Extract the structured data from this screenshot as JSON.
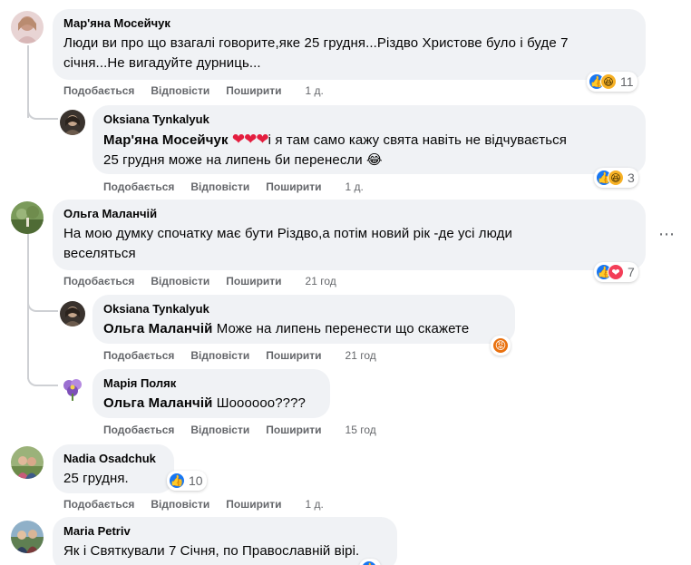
{
  "actions": {
    "like": "Подобається",
    "reply": "Відповісти",
    "share": "Поширити"
  },
  "comments": [
    {
      "author": "Мар'яна Мосейчук",
      "line1": "Люди ви про що взагалі говорите,яке 25 грудня...Різдво Христове було і буде 7",
      "line2": "січня...Не вигадуйте дурниць...",
      "time": "1 д.",
      "reactions": {
        "icons": [
          "like-icon",
          "haha-icon"
        ],
        "count": "11"
      }
    },
    {
      "author": "Oksiana Tynkalyuk",
      "mention": "Мар'яна Мосейчук",
      "hearts": "❤❤❤",
      "line1_rest": "і я там само кажу свята навіть не відчувається",
      "line2": "25 грудня може на липень би перенесли",
      "trailing_emoji": "😂",
      "time": "1 д.",
      "reactions": {
        "icons": [
          "like-icon",
          "haha-icon"
        ],
        "count": "3"
      }
    },
    {
      "author": "Ольга Маланчій",
      "line1": "На мою думку спочатку має бути Різдво,а потім новий рік -де усі люди",
      "line2": "веселяться",
      "time": "21 год",
      "reactions": {
        "icons": [
          "like-icon",
          "love-icon"
        ],
        "count": "7"
      }
    },
    {
      "author": "Oksiana Tynkalyuk",
      "mention": "Ольга Маланчій",
      "text": "Може на липень перенести що скажете",
      "time": "21 год",
      "reactions": {
        "icons": [
          "angry-icon"
        ],
        "count": ""
      }
    },
    {
      "author": "Марія Поляк",
      "mention": "Ольга Маланчій",
      "text": "Шоооооо????",
      "time": "15 год"
    },
    {
      "author": "Nadia Osadchuk",
      "text": "25 грудня.",
      "time": "1 д.",
      "reactions": {
        "icons": [
          "like-icon"
        ],
        "count": "10"
      }
    },
    {
      "author": "Maria Petriv",
      "text": "Як і Святкували 7 Січня, по Православній вірі."
    }
  ],
  "colors": {
    "bubble": "#f0f2f5",
    "secondary_text": "#65676b",
    "like_blue": "#1877f2",
    "love_red": "#f33e58",
    "haha_yellow": "#f7b125",
    "angry_orange": "#e9710f",
    "thread_line": "#ced0d4"
  }
}
